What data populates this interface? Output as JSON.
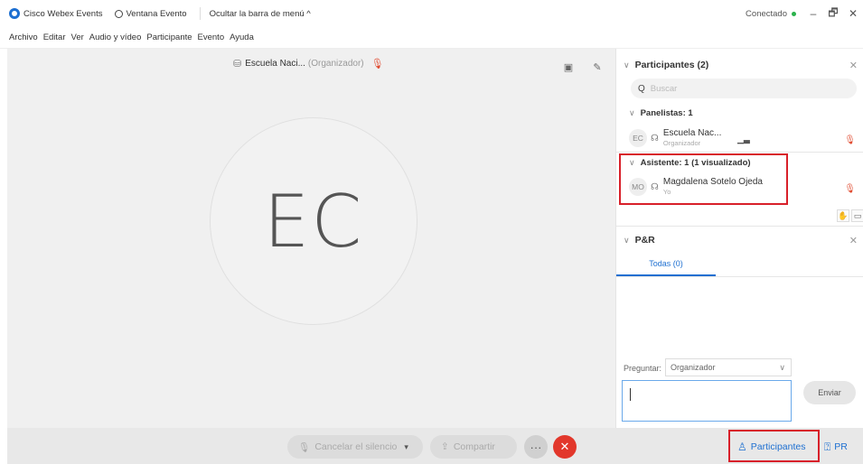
{
  "titlebar": {
    "app_name": "Cisco Webex Events",
    "event_window": "Ventana Evento",
    "hide_menu": "Ocultar la barra de menú ^",
    "status": "Conectado",
    "minimize": "–",
    "restore": "🗗",
    "close": "✕"
  },
  "menu": [
    "Archivo",
    "Editar",
    "Ver",
    "Audio y vídeo",
    "Participante",
    "Evento",
    "Ayuda"
  ],
  "stage": {
    "presenter_name": "Escuela Naci...",
    "presenter_role": "(Organizador)",
    "avatar_initials": "EC"
  },
  "participants_panel": {
    "title": "Participantes (2)",
    "search_placeholder": "Buscar",
    "panelists_header": "Panelistas: 1",
    "panelist": {
      "initials": "EC",
      "name": "Escuela Nac...",
      "role": "Organizador"
    },
    "attendees_header": "Asistente: 1 (1 visualizado)",
    "attendee": {
      "initials": "MO",
      "name": "Magdalena Sotelo Ojeda",
      "role": "Yo"
    }
  },
  "qa_panel": {
    "title": "P&R",
    "tab_all": "Todas (0)",
    "ask_label": "Preguntar:",
    "ask_to": "Organizador",
    "send": "Enviar"
  },
  "bottombar": {
    "unmute": "Cancelar el silencio",
    "share": "Compartir",
    "more": "···",
    "end": "✕",
    "participants": "Participantes",
    "qa": "PR"
  },
  "colors": {
    "accent": "#1d6fd1",
    "end_call": "#e2372b",
    "connected": "#2bb24c",
    "highlight_box": "#d8202a"
  }
}
